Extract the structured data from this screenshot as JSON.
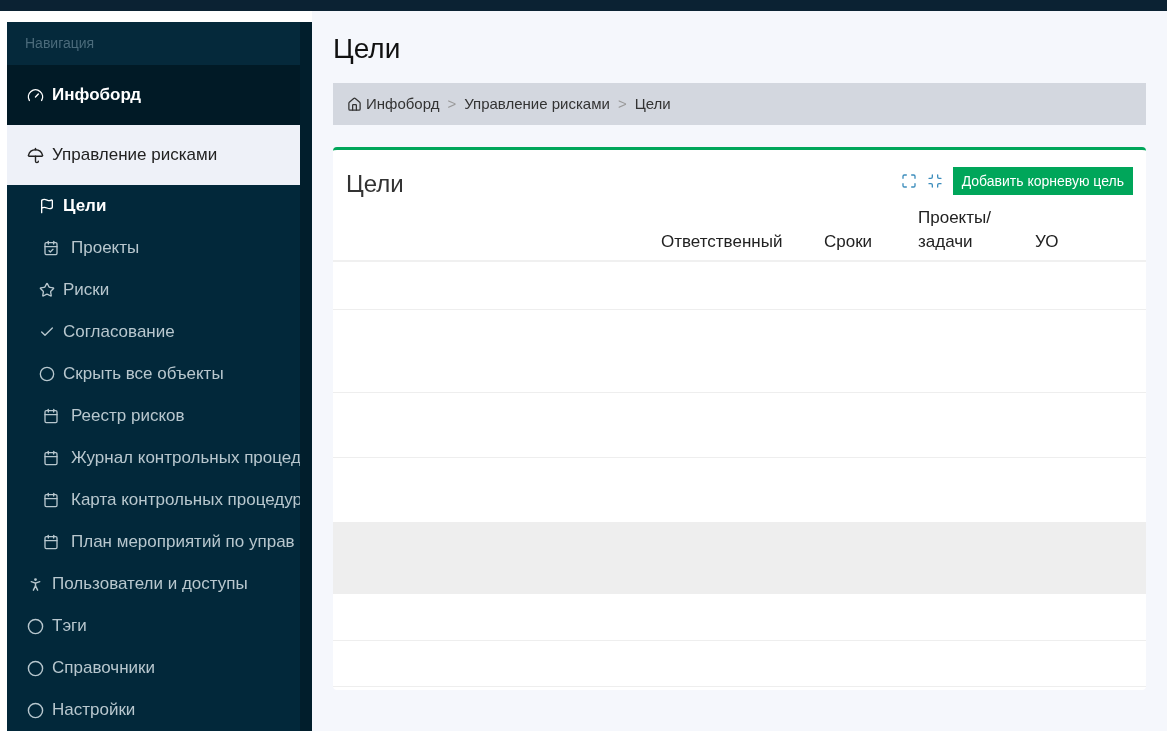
{
  "sidebar": {
    "header": "Навигация",
    "items": [
      {
        "label": "Инфоборд",
        "selected": false,
        "highlighted": true
      },
      {
        "label": "Управление рисками",
        "selected": true,
        "highlighted": false,
        "children": [
          {
            "label": "Цели",
            "selected": true
          },
          {
            "label": "Проекты",
            "selected": false
          },
          {
            "label": "Риски",
            "selected": false
          },
          {
            "label": "Согласование",
            "selected": false
          },
          {
            "label": "Скрыть все объекты",
            "selected": false
          },
          {
            "label": "Реестр рисков",
            "selected": false
          },
          {
            "label": "Журнал контрольных процед",
            "selected": false
          },
          {
            "label": "Карта контрольных процедур",
            "selected": false
          },
          {
            "label": "План мероприятий по управ",
            "selected": false
          }
        ]
      },
      {
        "label": "Пользователи и доступы",
        "selected": false,
        "highlighted": false
      },
      {
        "label": "Тэги",
        "selected": false,
        "highlighted": false
      },
      {
        "label": "Справочники",
        "selected": false,
        "highlighted": false
      },
      {
        "label": "Настройки",
        "selected": false,
        "highlighted": false
      }
    ]
  },
  "page": {
    "title": "Цели",
    "breadcrumb": [
      "Инфоборд",
      "Управление рисками",
      "Цели"
    ],
    "breadcrumb_separator": ">"
  },
  "card": {
    "title": "Цели",
    "add_button": "Добавить корневую цель",
    "columns": [
      "Ответственный",
      "Сроки",
      "Проекты/ задачи",
      "УО"
    ],
    "rows": [
      {
        "highlighted": false
      },
      {
        "highlighted": false
      },
      {
        "highlighted": false
      },
      {
        "highlighted": false
      },
      {
        "highlighted": true
      },
      {
        "highlighted": false
      },
      {
        "highlighted": false
      }
    ]
  }
}
